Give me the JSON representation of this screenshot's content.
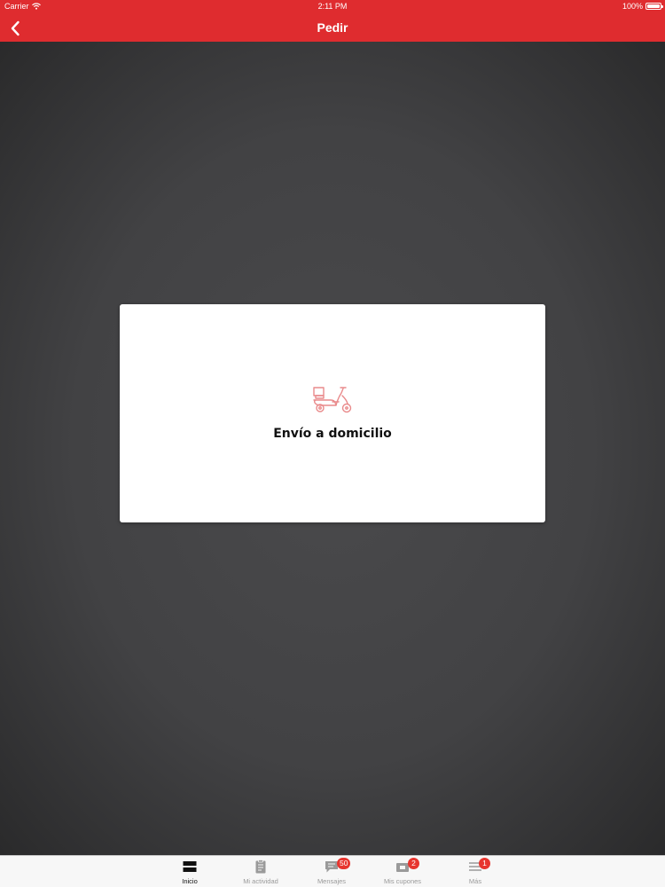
{
  "status_bar": {
    "carrier": "Carrier",
    "time": "2:11 PM",
    "battery": "100%",
    "battery_level": 1.0
  },
  "nav": {
    "title": "Pedir",
    "back_icon": "chevron-left-icon"
  },
  "card": {
    "icon": "scooter-icon",
    "label": "Envío a domicilio"
  },
  "tabs": [
    {
      "label": "Inicio",
      "icon": "home-icon",
      "active": true,
      "badge": null
    },
    {
      "label": "Mi actividad",
      "icon": "clipboard-icon",
      "active": false,
      "badge": null
    },
    {
      "label": "Mensajes",
      "icon": "chat-icon",
      "active": false,
      "badge": "50"
    },
    {
      "label": "Mis cupones",
      "icon": "coupon-icon",
      "active": false,
      "badge": "2"
    },
    {
      "label": "Más",
      "icon": "menu-icon",
      "active": false,
      "badge": "1"
    }
  ],
  "colors": {
    "brand_red": "#df2c2f",
    "badge_red": "#e7352f",
    "icon_pink": "#e98a8b"
  }
}
